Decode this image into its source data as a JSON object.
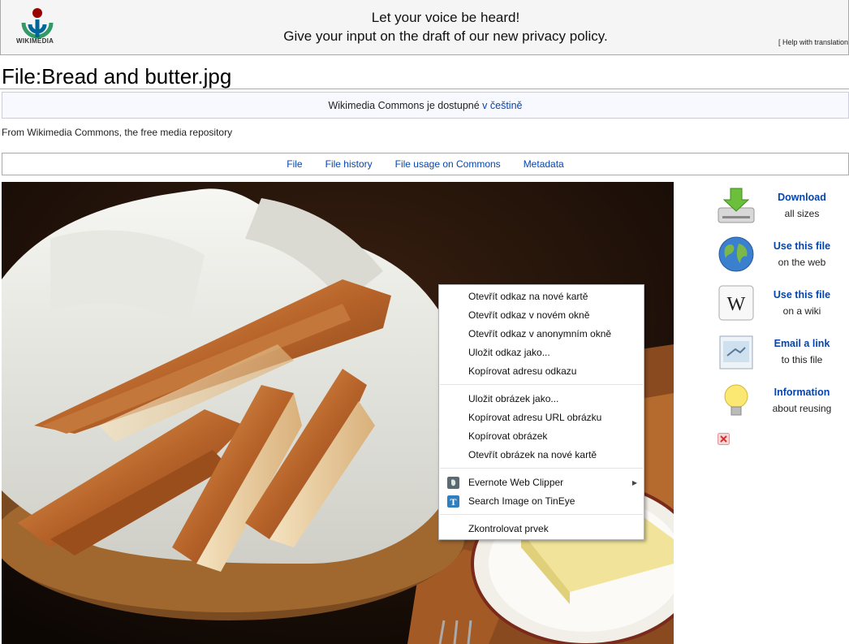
{
  "banner": {
    "logo_text": "WIKIMEDIA",
    "line1": "Let your voice be heard!",
    "line2": "Give your input on the draft of our new privacy policy.",
    "help": "[ Help with translations"
  },
  "page": {
    "title": "File:Bread and butter.jpg",
    "lang_notice_prefix": "Wikimedia Commons je dostupné ",
    "lang_notice_link": "v češtině",
    "site_sub": "From Wikimedia Commons, the free media repository"
  },
  "tabs": [
    "File",
    "File history",
    "File usage on Commons",
    "Metadata"
  ],
  "side_tools": [
    {
      "title": "Download",
      "sub": "all sizes",
      "icon": "download-icon"
    },
    {
      "title": "Use this file",
      "sub": "on the web",
      "icon": "globe-icon"
    },
    {
      "title": "Use this file",
      "sub": "on a wiki",
      "icon": "wikipedia-icon"
    },
    {
      "title": "Email a link",
      "sub": "to this file",
      "icon": "email-icon"
    },
    {
      "title": "Information",
      "sub": "about reusing",
      "icon": "lightbulb-icon"
    }
  ],
  "context_menu": {
    "items": [
      "Otevřít odkaz na nové kartě",
      "Otevřít odkaz v novém okně",
      "Otevřít odkaz v anonymním okně",
      "Uložit odkaz jako...",
      "Kopírovat adresu odkazu",
      "Uložit obrázek jako...",
      "Kopírovat adresu URL obrázku",
      "Kopírovat obrázek",
      "Otevřít obrázek na nové kartě",
      "Evernote Web Clipper",
      "Search Image on TinEye",
      "Zkontrolovat prvek"
    ]
  },
  "colors": {
    "link": "#0645ad",
    "banner_bg": "#f5f5f5"
  }
}
